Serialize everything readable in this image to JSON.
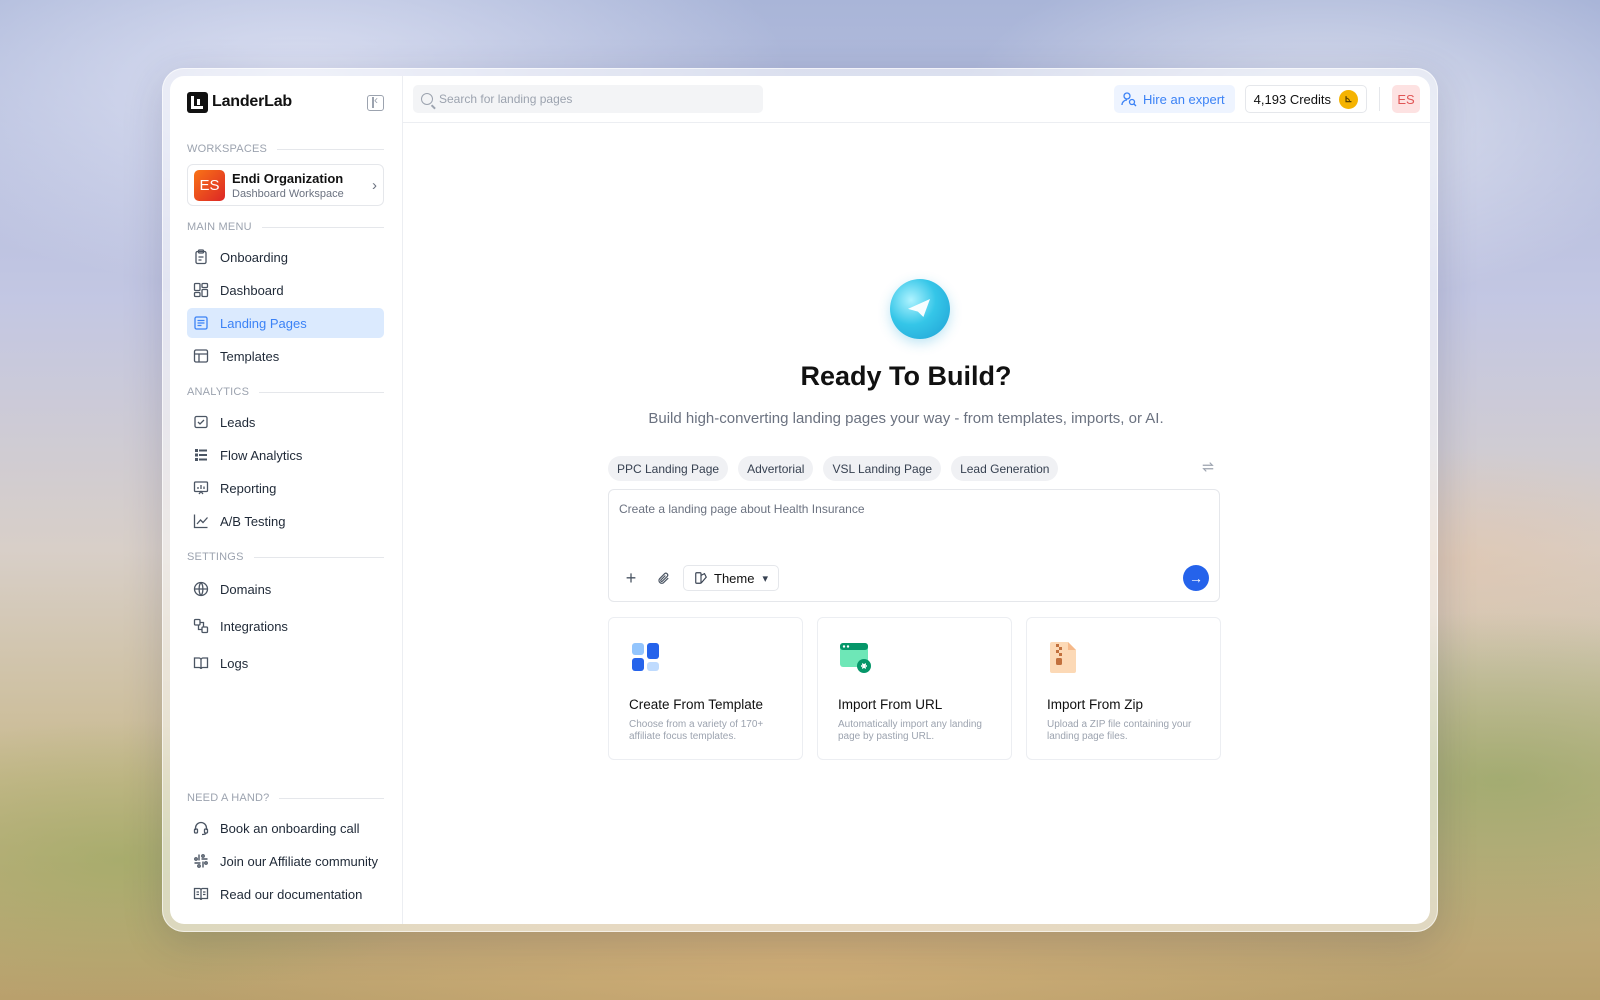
{
  "brand": {
    "name": "LanderLab"
  },
  "sidebar": {
    "workspaces_label": "WORKSPACES",
    "workspace": {
      "avatar": "ES",
      "name": "Endi Organization",
      "subtitle": "Dashboard Workspace"
    },
    "main_menu_label": "MAIN MENU",
    "main_menu": [
      {
        "label": "Onboarding",
        "icon": "clipboard-icon"
      },
      {
        "label": "Dashboard",
        "icon": "dashboard-icon"
      },
      {
        "label": "Landing Pages",
        "icon": "page-icon",
        "active": true
      },
      {
        "label": "Templates",
        "icon": "template-icon"
      }
    ],
    "analytics_label": "ANALYTICS",
    "analytics": [
      {
        "label": "Leads",
        "icon": "leads-icon"
      },
      {
        "label": "Flow Analytics",
        "icon": "flow-icon"
      },
      {
        "label": "Reporting",
        "icon": "report-icon"
      },
      {
        "label": "A/B Testing",
        "icon": "chart-line-icon"
      }
    ],
    "settings_label": "SETTINGS",
    "settings": [
      {
        "label": "Domains",
        "icon": "globe-icon"
      },
      {
        "label": "Integrations",
        "icon": "integrations-icon"
      },
      {
        "label": "Logs",
        "icon": "book-icon"
      }
    ],
    "help_label": "NEED A HAND?",
    "help": [
      {
        "label": "Book an onboarding call",
        "icon": "headset-icon"
      },
      {
        "label": "Join our Affiliate community",
        "icon": "slack-icon"
      },
      {
        "label": "Read our documentation",
        "icon": "docs-icon"
      }
    ]
  },
  "topbar": {
    "search_placeholder": "Search for landing pages",
    "hire_label": "Hire an expert",
    "credits_label": "4,193 Credits",
    "user_initials": "ES"
  },
  "hero": {
    "title": "Ready To Build?",
    "subtitle": "Build high-converting landing pages your way - from templates, imports, or AI.",
    "chips": [
      "PPC Landing Page",
      "Advertorial",
      "VSL Landing Page",
      "Lead Generation"
    ],
    "prompt_placeholder": "Create a landing page about Health Insurance",
    "theme_label": "Theme"
  },
  "cards": [
    {
      "title": "Create From Template",
      "desc": "Choose from a variety of 170+ affiliate focus templates.",
      "icon": "template-grid-icon"
    },
    {
      "title": "Import From URL",
      "desc": "Automatically import any landing page by pasting URL.",
      "icon": "browser-link-icon"
    },
    {
      "title": "Import From Zip",
      "desc": "Upload a ZIP file containing your landing page files.",
      "icon": "zip-file-icon"
    }
  ],
  "colors": {
    "accent": "#3b82f6",
    "active_bg": "#dbeafe",
    "send": "#2563eb",
    "coin": "#f5b301"
  }
}
